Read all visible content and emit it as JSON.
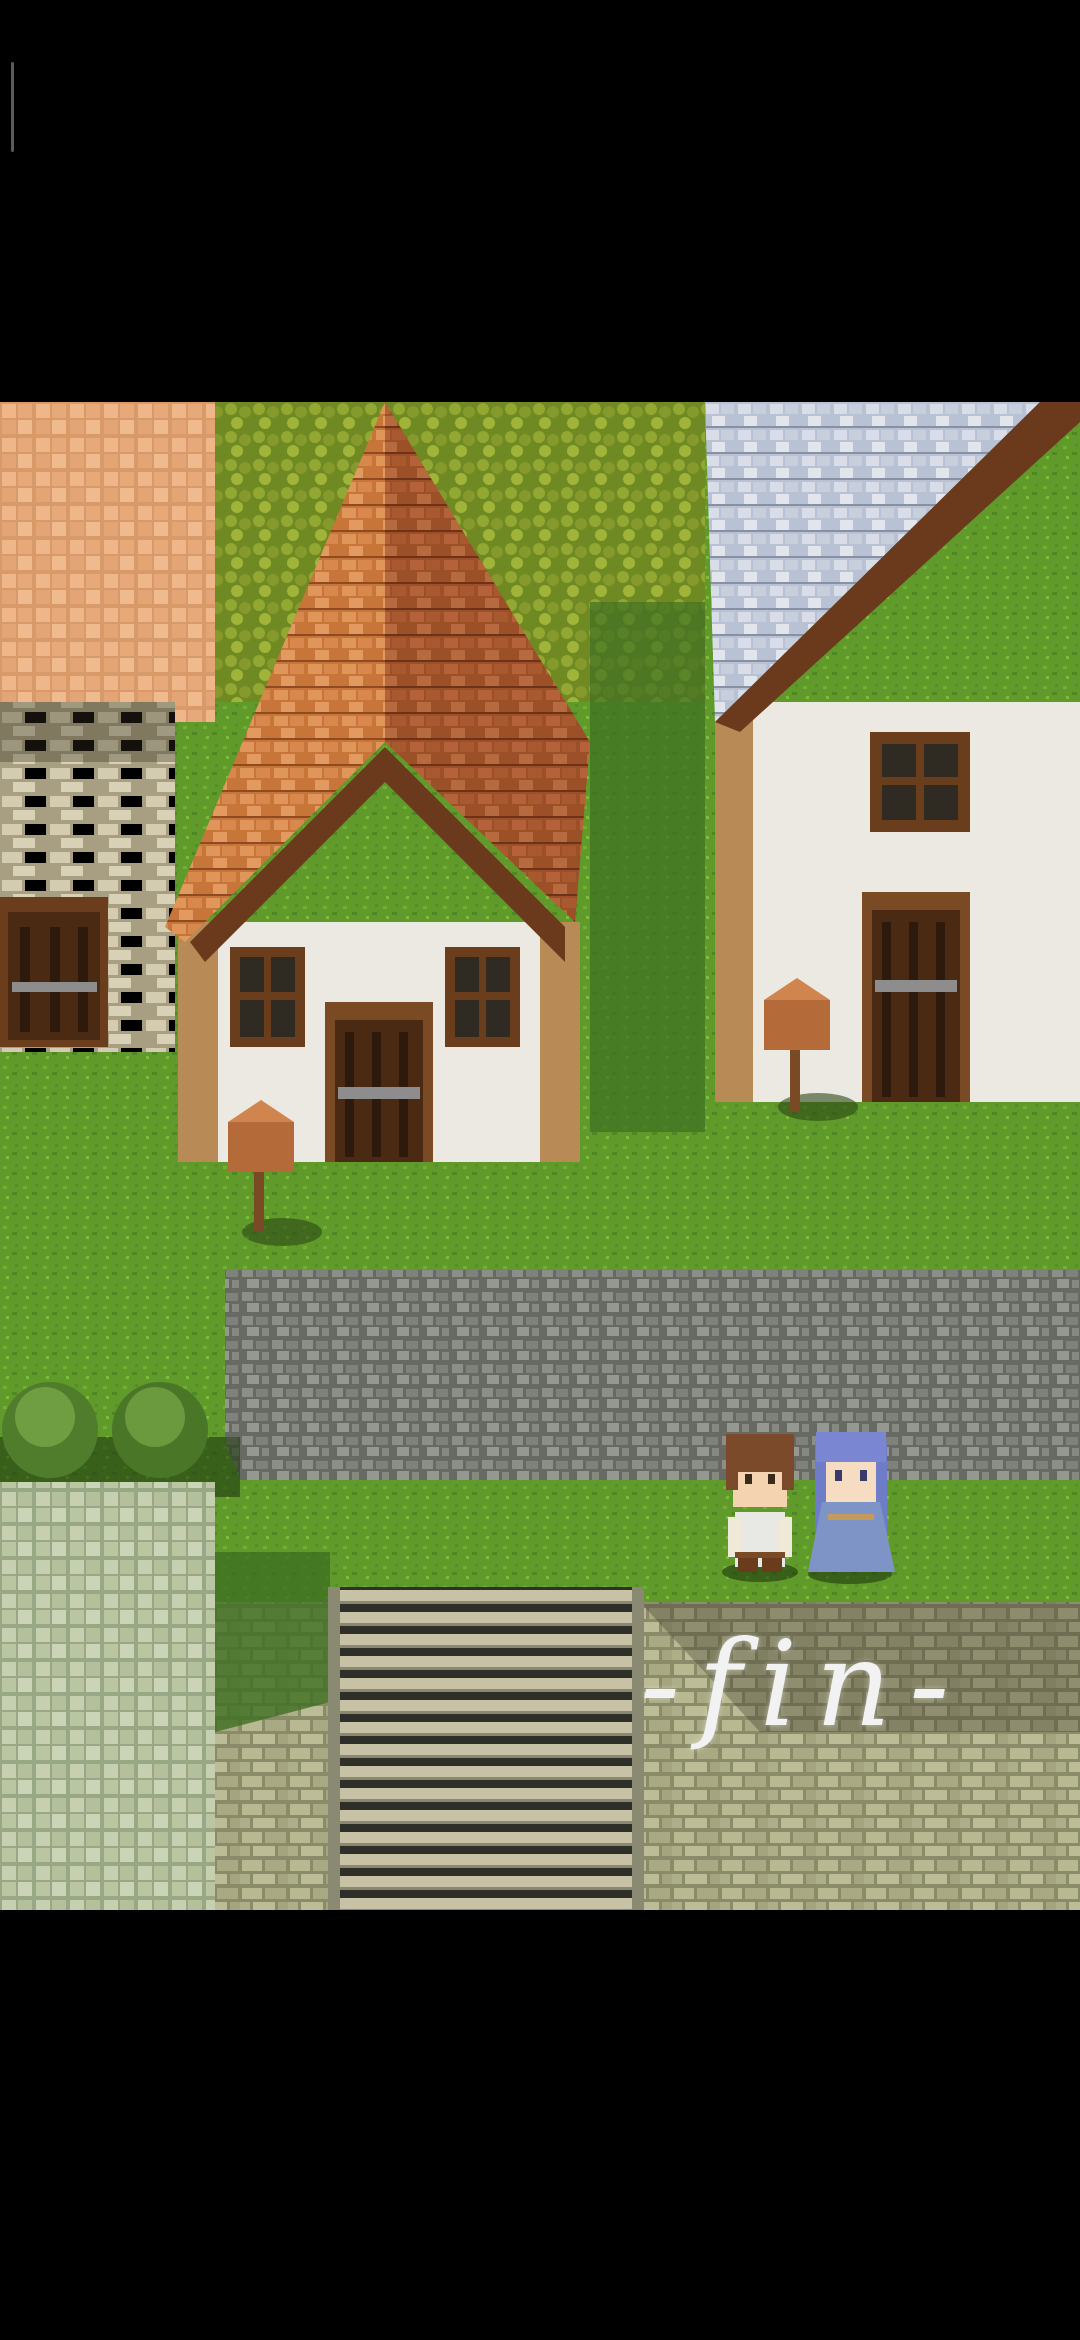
{
  "ending": {
    "text": "-fin-"
  },
  "palette": {
    "letterbox": "#000000",
    "grass": "#5f9a2a",
    "roof_orange": "#c8753a",
    "roof_blue": "#b8c4d8",
    "wall_white": "#ece9e2",
    "cobblestone": "#7c7f78",
    "stone_wall": "#a6a884"
  },
  "characters": [
    {
      "id": "hero",
      "hair": "#7a4a2a",
      "outfit": "#e8e8e4"
    },
    {
      "id": "heroine",
      "hair": "#6f7cc8",
      "outfit": "#7f94c6"
    }
  ]
}
